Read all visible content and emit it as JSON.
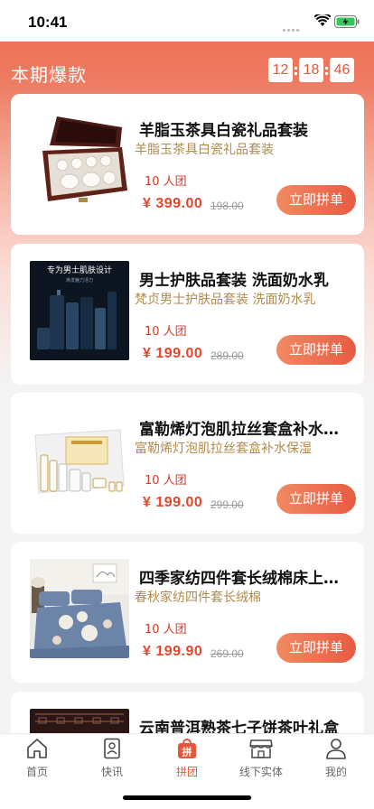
{
  "status": {
    "time": "10:41"
  },
  "header": {
    "title": "本期爆款",
    "countdown": {
      "hours": "12",
      "minutes": "18",
      "seconds": "46"
    }
  },
  "products": [
    {
      "title": "羊脂玉茶具白瓷礼品套装",
      "subtitle": "羊脂玉茶具白瓷礼品套装",
      "group": "10 人团",
      "price": "¥ 399.00",
      "original": "198.00",
      "button": "立即拼单",
      "image": "tea-set-image"
    },
    {
      "title": "男士护肤品套装 洗面奶水乳",
      "subtitle": "梵贞男士护肤品套装 洗面奶水乳",
      "group": "10 人团",
      "price": "¥ 199.00",
      "original": "289.00",
      "button": "立即拼单",
      "image": "men-skincare-image",
      "image_text": "专为男士肌肤设计",
      "image_subtext": "焕发魅力活力"
    },
    {
      "title": "富勒烯灯泡肌拉丝套盒补水保湿",
      "subtitle": "富勒烯灯泡肌拉丝套盒补水保湿",
      "group": "10 人团",
      "price": "¥ 199.00",
      "original": "299.00",
      "button": "立即拼单",
      "image": "skincare-box-image"
    },
    {
      "title": "四季家纺四件套长绒棉床上用品",
      "subtitle": "春秋家纺四件套长绒棉",
      "group": "10 人团",
      "price": "¥ 199.90",
      "original": "269.00",
      "button": "立即拼单",
      "image": "bedding-image"
    },
    {
      "title": "云南普洱熟茶七子饼茶叶礼盒",
      "image": "puer-tea-image"
    }
  ],
  "tabs": [
    {
      "label": "首页",
      "icon": "home-icon"
    },
    {
      "label": "快讯",
      "icon": "news-icon"
    },
    {
      "label": "拼团",
      "icon": "group-buy-icon",
      "active": true
    },
    {
      "label": "线下实体",
      "icon": "store-icon"
    },
    {
      "label": "我的",
      "icon": "profile-icon"
    }
  ],
  "colors": {
    "accent": "#e9553a",
    "gold": "#b08a4a",
    "price": "#e5452a"
  }
}
